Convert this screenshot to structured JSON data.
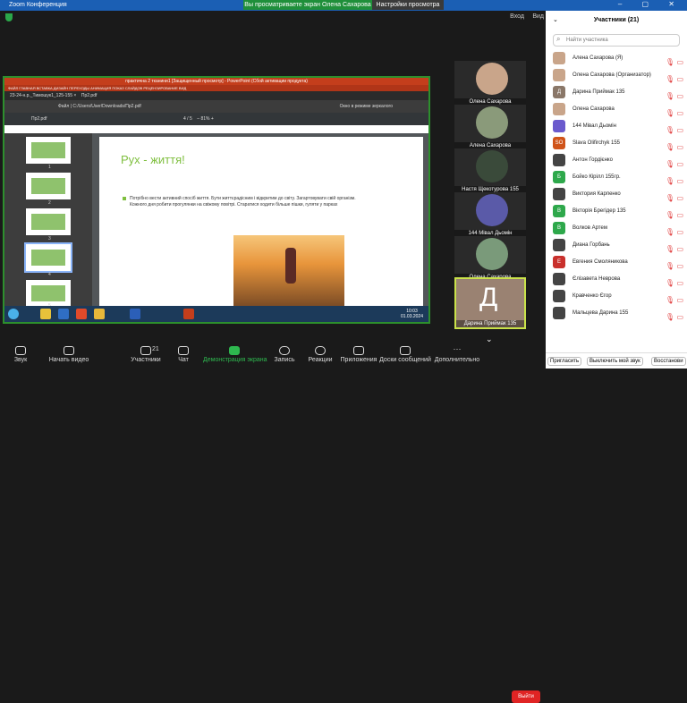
{
  "window": {
    "title": "Zoom Конференция",
    "share_banner": "Вы просматриваете экран Олена Сахарова",
    "view_options": "Настройки просмотра"
  },
  "topbar": {
    "enter": "Вход",
    "view": "Вид"
  },
  "presentation": {
    "ppt_title": "практична 2 тканини1 [Защищенный просмотр] - PowerPoint (Сбой активации продукта)",
    "ribbon": "ФАЙЛ   ГЛАВНАЯ   ВСТАВКА   ДИЗАЙН   ПЕРЕХОДЫ   АНИМАЦИЯ   ПОКАЗ СЛАЙДОВ   РЕЦЕНЗИРОВАНИЕ   ВИД",
    "tab1": "23-24-н.р._Тимошук1_125-155 ×",
    "tab2": "Пр2.pdf",
    "address": "Файл | C:/Users/User/Downloads/Пр2.pdf",
    "reader_mode": "Окно в режиме зеркалого",
    "pdf_name": "Пр2.pdf",
    "page_num": "4",
    "page_total": "/ 5",
    "zoom": "81%",
    "thumb_nums": [
      "1",
      "2",
      "3",
      "4",
      "5"
    ],
    "slide_title": "Рух - життя!",
    "slide_text": "Потрібно вести активний спосіб життя. Бути життєрадісним і відкритим до світу. Загартовувати свій організм. Кожного дня робити прогулянки на свіжому повітрі. Старатися ходити більше пішки, гуляти у парках",
    "clock_time": "10:03",
    "clock_date": "01.03.2024"
  },
  "tiles": [
    "Олена Сахарова",
    "Алена Сахарова",
    "Настя Щекотурова 155",
    "144 Мівал Дьомін",
    "Олена Сахарова",
    "Дарина Приймак 135"
  ],
  "tile_letter": "Д",
  "toolbar": {
    "sound": "Звук",
    "video": "Начать видео",
    "participants": "Участники",
    "participants_count": "21",
    "chat": "Чат",
    "share": "Демонстрация экрана",
    "record": "Запись",
    "reactions": "Реакции",
    "apps": "Приложения",
    "whiteboard": "Доски сообщений",
    "more": "Дополнительно",
    "end": "Выйти"
  },
  "panel": {
    "title": "Участники (21)",
    "search": "Найти участника",
    "participants": [
      {
        "name": "Алена Сахарова (Я)",
        "initials": "",
        "color": "#c9a58a"
      },
      {
        "name": "Олена Сахарова (Организатор)",
        "initials": "",
        "color": "#c9a58a"
      },
      {
        "name": "Дарина Приймак 135",
        "initials": "Д",
        "color": "#8a7768"
      },
      {
        "name": "Олена Сахарова",
        "initials": "",
        "color": "#c9a58a"
      },
      {
        "name": "144 Мівал Дьомін",
        "initials": "",
        "color": "#6a5acd"
      },
      {
        "name": "Slava Olifirchyk 155",
        "initials": "SO",
        "color": "#d0541a"
      },
      {
        "name": "Антон Гордієнко",
        "initials": "",
        "color": "#444"
      },
      {
        "name": "Бойко Кірілл 155гр.",
        "initials": "Б",
        "color": "#2ea84b"
      },
      {
        "name": "Виктория Карпенко",
        "initials": "",
        "color": "#444"
      },
      {
        "name": "Вікторія Брегідер 135",
        "initials": "В",
        "color": "#2ea84b"
      },
      {
        "name": "Волков Артем",
        "initials": "В",
        "color": "#2ea84b"
      },
      {
        "name": "Диана Горбань",
        "initials": "",
        "color": "#444"
      },
      {
        "name": "Евгения Смоляникова",
        "initials": "Е",
        "color": "#c9302c"
      },
      {
        "name": "Єлізавета Неврова",
        "initials": "",
        "color": "#444"
      },
      {
        "name": "Кравченко Єгор",
        "initials": "",
        "color": "#444"
      },
      {
        "name": "Мальцева Дарина 155",
        "initials": "",
        "color": "#444"
      }
    ],
    "invite": "Пригласить",
    "mute_all": "Выключить мой звук",
    "restore": "Восстанови"
  }
}
